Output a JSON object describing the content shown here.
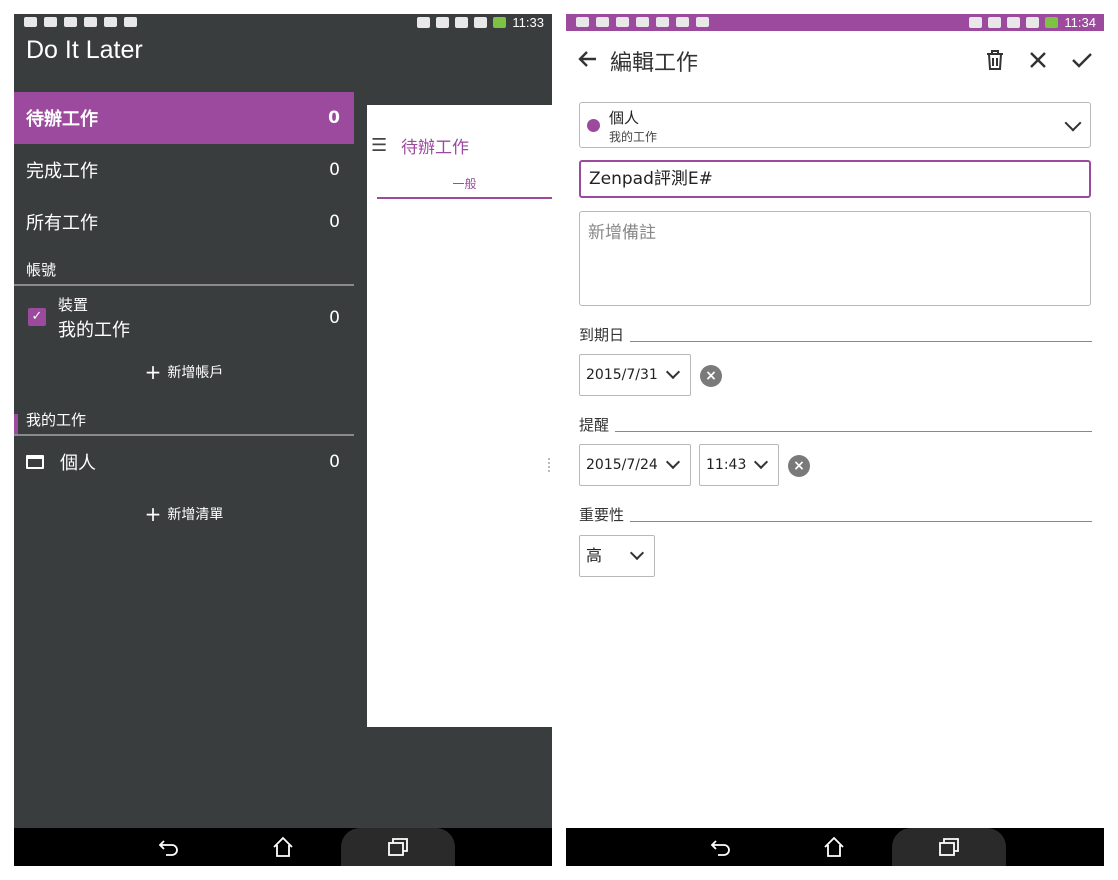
{
  "left_phone": {
    "status_time": "11:33",
    "app_title": "Do It Later",
    "nav": [
      {
        "label": "待辦工作",
        "count": "0"
      },
      {
        "label": "完成工作",
        "count": "0"
      },
      {
        "label": "所有工作",
        "count": "0"
      }
    ],
    "accounts_header": "帳號",
    "account": {
      "type": "裝置",
      "name": "我的工作",
      "count": "0"
    },
    "add_account": "新增帳戶",
    "lists_header": "我的工作",
    "list": {
      "name": "個人",
      "count": "0"
    },
    "add_list": "新增清單",
    "peek": {
      "menu_glyph": "☰",
      "title": "待辦工作",
      "tab": "一般"
    }
  },
  "right_phone": {
    "status_time": "11:34",
    "title": "編輯工作",
    "list_select": {
      "name": "個人",
      "owner": "我的工作"
    },
    "task_title": "Zenpad評測E#",
    "note_placeholder": "新增備註",
    "due_label": "到期日",
    "due_date": "2015/7/31",
    "reminder_label": "提醒",
    "reminder_date": "2015/7/24",
    "reminder_time": "11:43",
    "priority_label": "重要性",
    "priority_value": "高"
  },
  "colors": {
    "accent": "#9b4a9d",
    "drawer_bg": "#3a3d3e",
    "navbar": "#000000"
  },
  "icons": [
    "back-arrow-icon",
    "delete-icon",
    "close-icon",
    "check-icon",
    "folder-icon",
    "checkbox-icon",
    "clear-icon",
    "back-nav-icon",
    "home-nav-icon",
    "recents-nav-icon"
  ]
}
